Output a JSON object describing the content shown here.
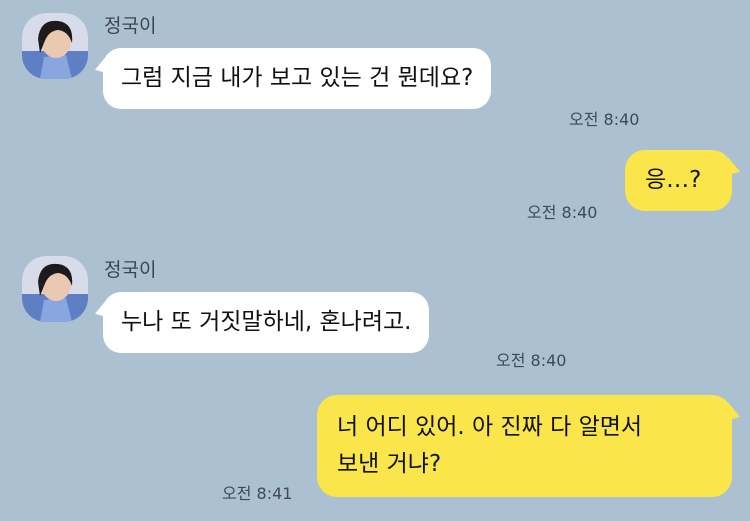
{
  "chat": {
    "messages": [
      {
        "direction": "in",
        "sender": "정국이",
        "text": "그럼 지금 내가 보고 있는 건 뭔데요?",
        "time": "오전 8:40"
      },
      {
        "direction": "out",
        "text": "응…?",
        "time": "오전 8:40"
      },
      {
        "direction": "in",
        "sender": "정국이",
        "text": "누나 또 거짓말하네, 혼나려고.",
        "time": "오전 8:40"
      },
      {
        "direction": "out",
        "lines": [
          "너 어디 있어. 아 진짜 다 알면서",
          "보낸 거냐?"
        ],
        "time": "오전 8:41"
      }
    ]
  },
  "colors": {
    "background": "#abc1d1",
    "incoming_bubble": "#ffffff",
    "outgoing_bubble": "#fae64b",
    "timestamp": "#3f4a55"
  },
  "icons": {
    "avatar": "profile-photo"
  }
}
